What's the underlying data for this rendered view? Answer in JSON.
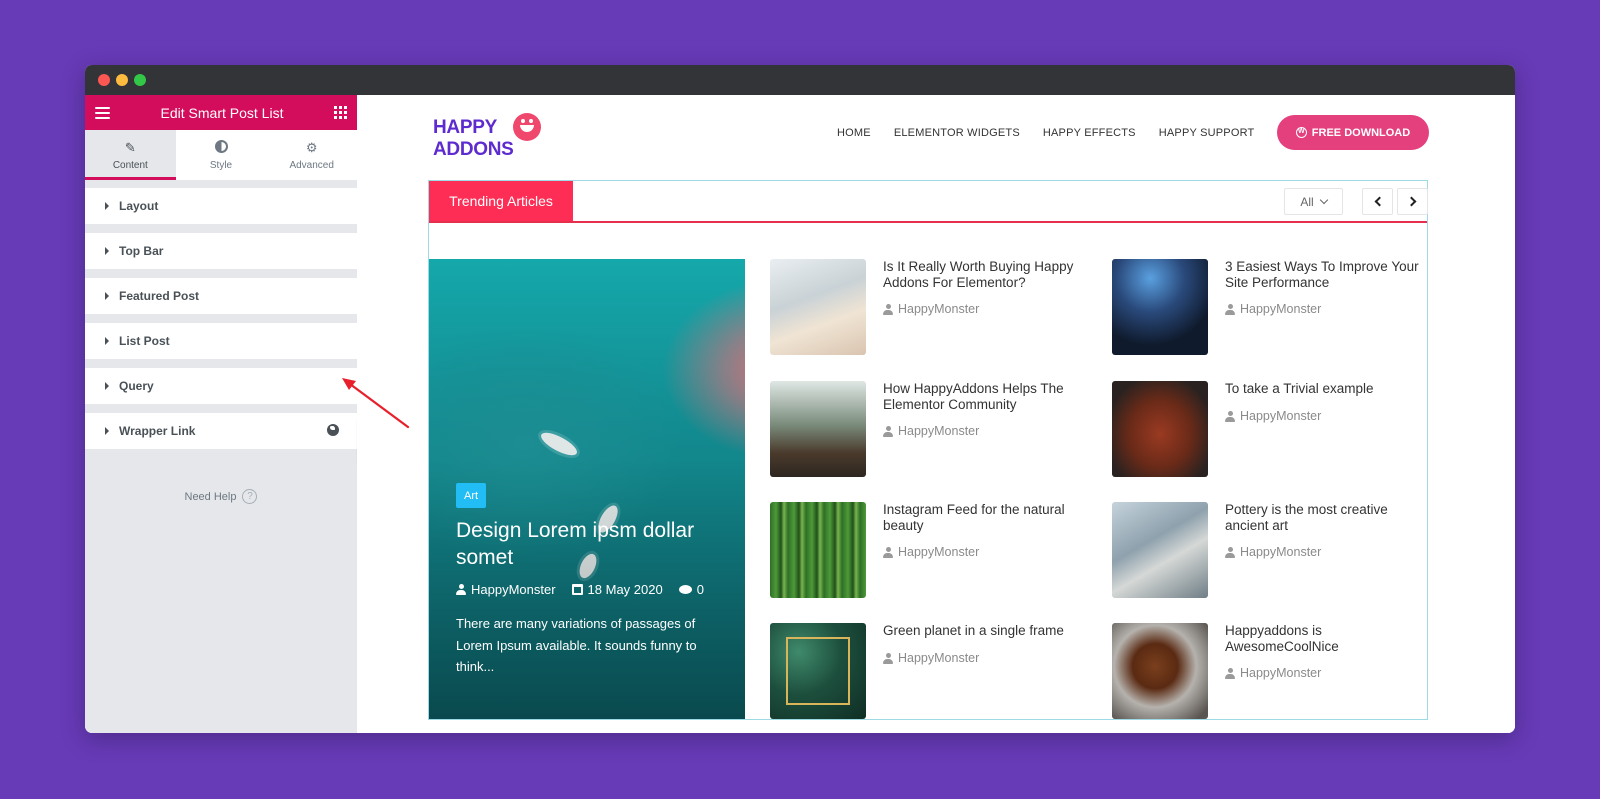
{
  "sidebar": {
    "header_title": "Edit Smart Post List",
    "tabs": [
      {
        "label": "Content",
        "icon": "pencil-icon"
      },
      {
        "label": "Style",
        "icon": "contrast-icon"
      },
      {
        "label": "Advanced",
        "icon": "gear-icon"
      }
    ],
    "sections": [
      "Layout",
      "Top Bar",
      "Featured Post",
      "List Post",
      "Query",
      "Wrapper Link"
    ],
    "need_help": "Need Help",
    "help_glyph": "?",
    "collapse_glyph": "‹"
  },
  "site": {
    "logo_line1": "HAPPY",
    "logo_line2": "ADDONS",
    "nav": [
      "HOME",
      "ELEMENTOR WIDGETS",
      "HAPPY EFFECTS",
      "HAPPY SUPPORT"
    ],
    "cta_label": "FREE DOWNLOAD",
    "cta_glyph": "W"
  },
  "widget": {
    "tab_label": "Trending Articles",
    "filter_value": "All",
    "featured": {
      "category": "Art",
      "title": "Design Lorem ipsm dollar somet",
      "author": "HappyMonster",
      "date": "18 May 2020",
      "comments": "0",
      "excerpt": "There are many variations of passages of Lorem Ipsum available. It sounds funny to think..."
    },
    "posts": [
      {
        "title": "Is It Really Worth Buying Happy Addons For Elementor?",
        "author": "HappyMonster"
      },
      {
        "title": "3 Easiest Ways To Improve Your Site Performance",
        "author": "HappyMonster"
      },
      {
        "title": "How HappyAddons Helps The Elementor Community",
        "author": "HappyMonster"
      },
      {
        "title": "To take a Trivial example",
        "author": "HappyMonster"
      },
      {
        "title": "Instagram Feed for the natural beauty",
        "author": "HappyMonster"
      },
      {
        "title": "Pottery is the most creative ancient art",
        "author": "HappyMonster"
      },
      {
        "title": "Green planet in a single frame",
        "author": "HappyMonster"
      },
      {
        "title": "Happyaddons is AwesomeCoolNice",
        "author": "HappyMonster"
      }
    ]
  },
  "colors": {
    "background": "#673ab7",
    "editor_accent": "#d30c5c",
    "trending_tab": "#fd2d55",
    "cta": "#e5407e",
    "badge": "#22bdf5",
    "annotation_arrow": "#e8202b"
  }
}
